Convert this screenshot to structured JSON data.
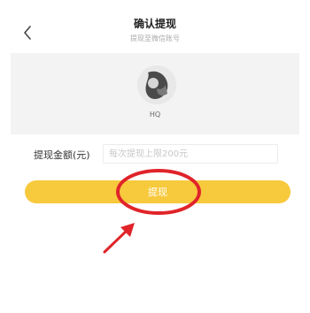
{
  "header": {
    "title": "确认提现",
    "subtitle": "提现至微信账号"
  },
  "profile": {
    "username": "HQ"
  },
  "form": {
    "amount_label": "提现金额(元)",
    "amount_placeholder": "每次提现上限200元",
    "amount_value": ""
  },
  "actions": {
    "withdraw_label": "提现"
  },
  "colors": {
    "accent": "#f7c93c",
    "annotation": "#e0242a"
  },
  "icons": {
    "back": "chevron-left-icon",
    "avatar": "avatar-image"
  }
}
